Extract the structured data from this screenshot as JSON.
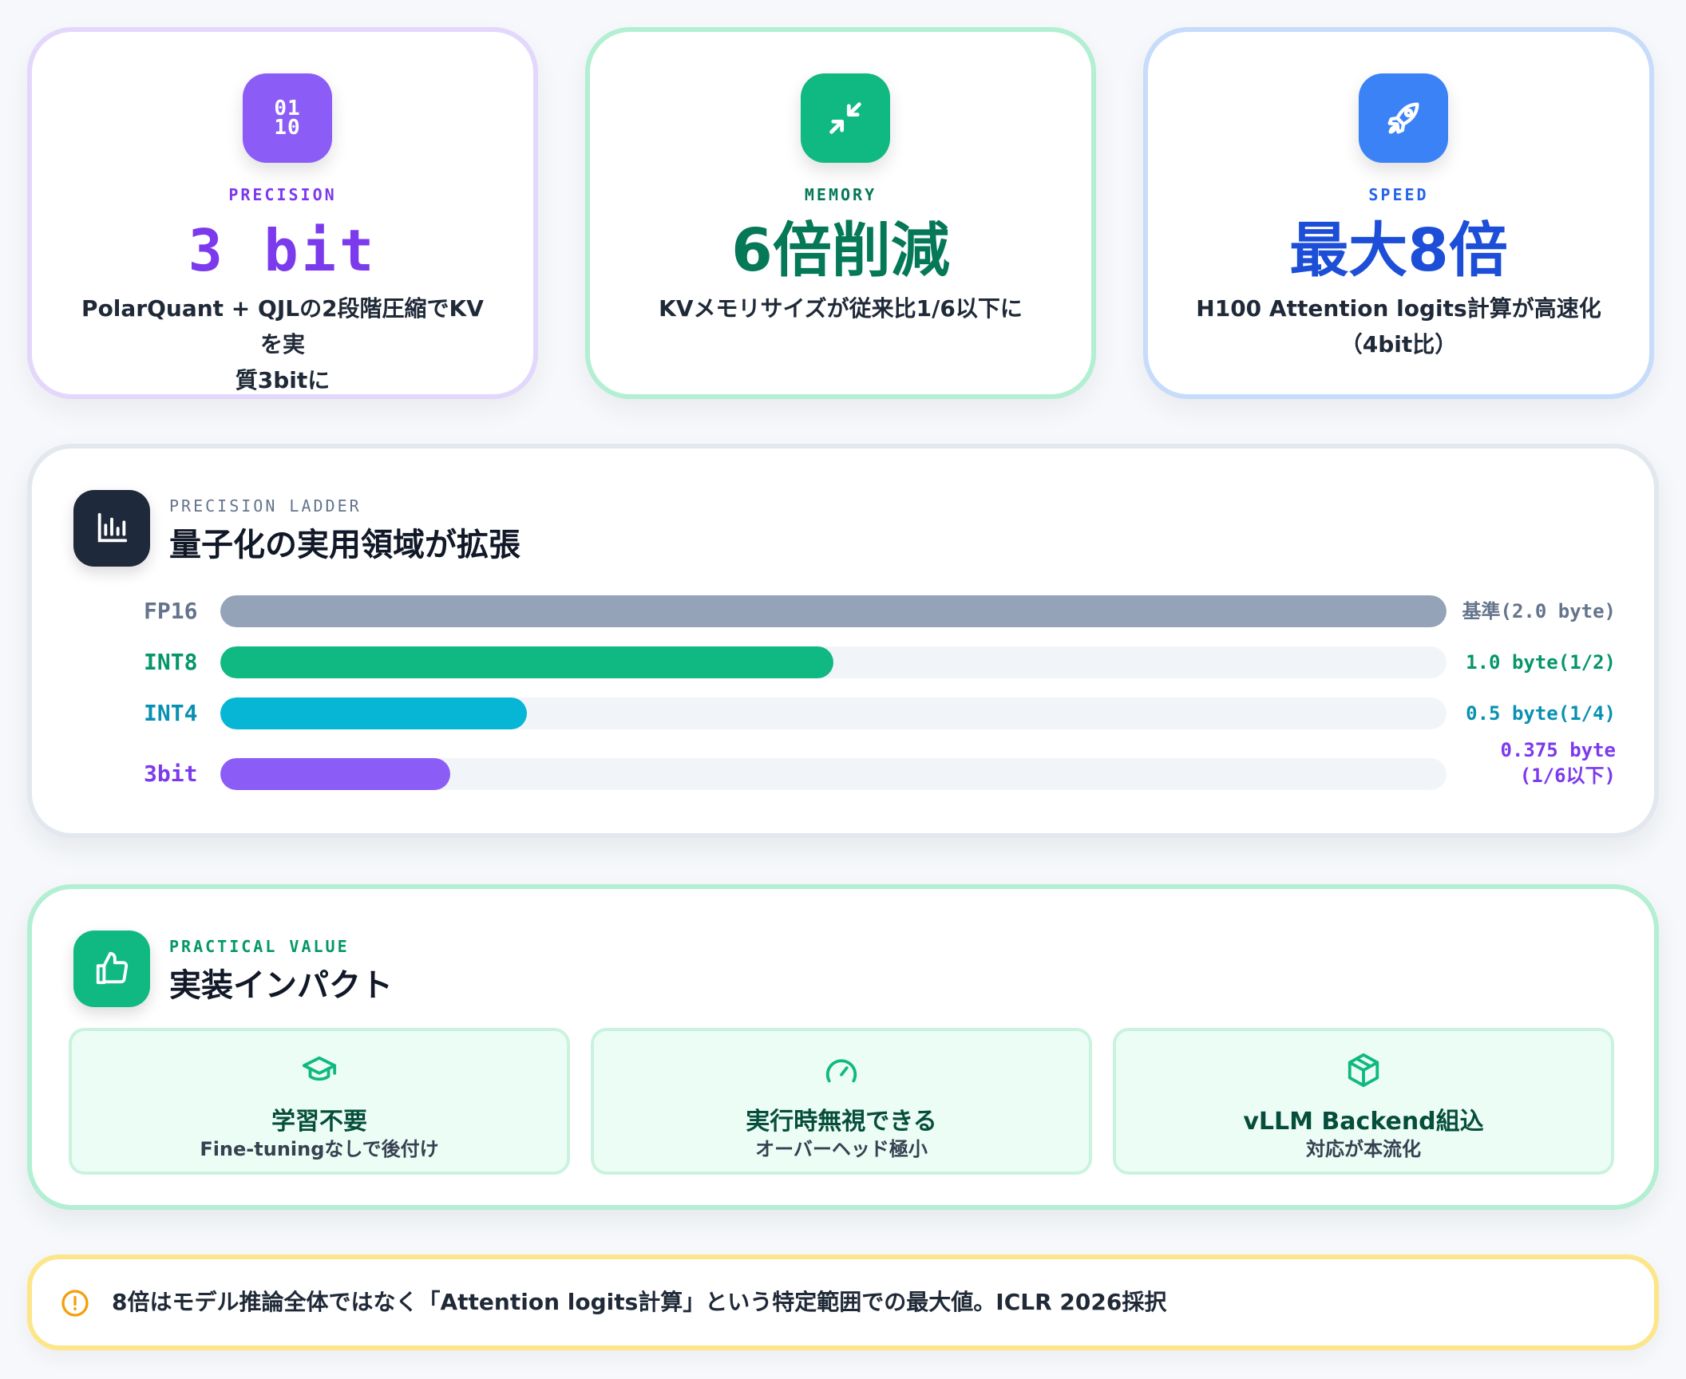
{
  "stats": {
    "precision": {
      "icon": "binary-icon",
      "glyph_top": "01",
      "glyph_bottom": "10",
      "label": "PRECISION",
      "value": "3 bit",
      "desc_line1": "PolarQuant + QJLの2段階圧縮でKVを実",
      "desc_line2": "質3bitに",
      "accent": "#8b5cf6"
    },
    "memory": {
      "icon": "compress-arrows-icon",
      "label": "MEMORY",
      "value": "6倍削減",
      "desc_line1": "KVメモリサイズが従来比1/6以下に",
      "accent": "#10b981"
    },
    "speed": {
      "icon": "rocket-icon",
      "label": "SPEED",
      "value": "最大8倍",
      "desc_line1": "H100 Attention logits計算が高速化",
      "desc_line2": "（4bit比）",
      "accent": "#3b82f6"
    }
  },
  "ladder": {
    "icon": "bar-chart-icon",
    "eyebrow": "PRECISION LADDER",
    "title": "量子化の実用領域が拡張",
    "rows": [
      {
        "label": "FP16",
        "value_line1": "基準(2.0 byte)",
        "value_line2": "",
        "fill_fraction": 1.0,
        "color": "#94a3b8",
        "label_color": "#64748b",
        "value_color": "#64748b"
      },
      {
        "label": "INT8",
        "value_line1": "1.0 byte(1/2)",
        "value_line2": "",
        "fill_fraction": 0.5,
        "color": "#10b981",
        "label_color": "#059669",
        "value_color": "#059669"
      },
      {
        "label": "INT4",
        "value_line1": "0.5 byte(1/4)",
        "value_line2": "",
        "fill_fraction": 0.25,
        "color": "#06b6d4",
        "label_color": "#0891b2",
        "value_color": "#0891b2"
      },
      {
        "label": "3bit",
        "value_line1": "0.375 byte",
        "value_line2": "(1/6以下)",
        "fill_fraction": 0.1875,
        "color": "#8b5cf6",
        "label_color": "#7c3aed",
        "value_color": "#7c3aed"
      }
    ]
  },
  "impact": {
    "icon": "thumbs-up-icon",
    "eyebrow": "PRACTICAL VALUE",
    "title": "実装インパクト",
    "tiles": [
      {
        "icon": "graduation-cap-icon",
        "title": "学習不要",
        "sub": "Fine-tuningなしで後付け"
      },
      {
        "icon": "gauge-icon",
        "title": "実行時無視できる",
        "sub": "オーバーヘッド極小"
      },
      {
        "icon": "package-box-icon",
        "title": "vLLM Backend組込",
        "sub": "対応が本流化"
      }
    ]
  },
  "note": {
    "icon": "alert-circle-icon",
    "text": "8倍はモデル推論全体ではなく「Attention logits計算」という特定範囲での最大値。ICLR 2026採択",
    "accent": "#f59e0b"
  }
}
